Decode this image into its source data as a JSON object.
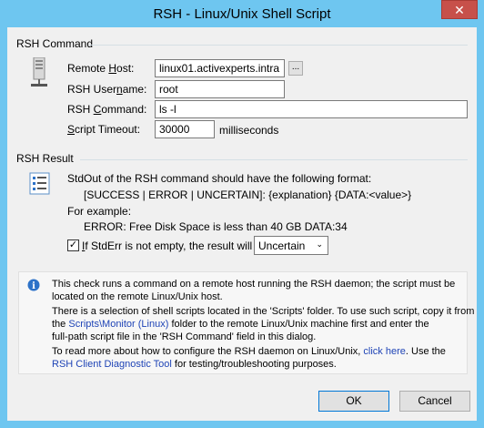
{
  "window": {
    "title": "RSH - Linux/Unix Shell Script",
    "close_glyph": "✕"
  },
  "command_group": {
    "title": "RSH Command",
    "host": {
      "label_pre": "Remote ",
      "label_key": "H",
      "label_post": "ost:",
      "value": "linux01.activexperts.intra",
      "browse_label": "..."
    },
    "username": {
      "label_pre": "RSH User",
      "label_key": "n",
      "label_post": "ame:",
      "value": "root"
    },
    "command": {
      "label_pre": "RSH ",
      "label_key": "C",
      "label_post": "ommand:",
      "value": "ls -l"
    },
    "timeout": {
      "label_pre": "",
      "label_key": "S",
      "label_post": "cript Timeout:",
      "value": "30000",
      "unit": "milliseconds"
    }
  },
  "result_group": {
    "title": "RSH Result",
    "line1": "StdOut of the RSH command should have the following format:",
    "line2": "[SUCCESS | ERROR | UNCERTAIN]: {explanation} {DATA:<value>}",
    "line3": "For example:",
    "line4": "ERROR: Free Disk Space is less than 40 GB DATA:34",
    "stderr": {
      "label_pre": "",
      "label_key": "I",
      "label_post": "f StdErr is not empty, the result will be:",
      "checked_glyph": "✓",
      "selected": "Uncertain",
      "arrow": "⌄"
    }
  },
  "info": {
    "icon_glyph": "i",
    "p1_line1": "This check runs a command on a remote host running the RSH daemon; the script must be",
    "p1_line2": "located on the remote Linux/Unix host.",
    "p2_line1": "There is a selection of shell scripts located in the 'Scripts' folder. To use such script, copy it from",
    "p2_line2_pre": "the ",
    "p2_line2_link": "Scripts\\Monitor (Linux)",
    "p2_line2_post": " folder to the remote Linux/Unix machine first and enter the",
    "p2_line3": "full-path script file in the 'RSH Command' field in this dialog.",
    "p3_line1_pre": "To read more about how to configure the RSH daemon on Linux/Unix, ",
    "p3_line1_link": "click here",
    "p3_line1_post": ". Use the",
    "p3_line2_link": "RSH Client Diagnostic Tool",
    "p3_line2_post": " for testing/troubleshooting purposes."
  },
  "buttons": {
    "ok": "OK",
    "cancel": "Cancel"
  },
  "colors": {
    "accent": "#6ec6f0",
    "link": "#1f44b6",
    "info_icon": "#2d72c8",
    "close": "#c7504a"
  }
}
